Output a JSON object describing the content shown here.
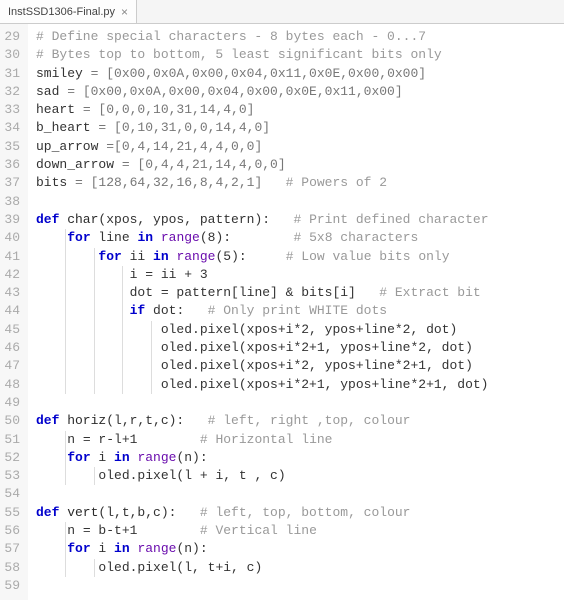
{
  "tab": {
    "filename": "InstSSD1306-Final.py",
    "close": "×"
  },
  "gutter_start": 29,
  "gutter_end": 59,
  "code": {
    "l29": {
      "comment": "# Define special characters - 8 bytes each - 0...7"
    },
    "l30": {
      "comment": "# Bytes top to bottom, 5 least significant bits only"
    },
    "l31": {
      "name": "smiley",
      "eq": " = ",
      "vals": "[0x00,0x0A,0x00,0x04,0x11,0x0E,0x00,0x00]"
    },
    "l32": {
      "name": "sad",
      "eq": " = ",
      "vals": "[0x00,0x0A,0x00,0x04,0x00,0x0E,0x11,0x00]"
    },
    "l33": {
      "name": "heart",
      "eq": " = ",
      "vals": "[0,0,0,10,31,14,4,0]"
    },
    "l34": {
      "name": "b_heart",
      "eq": " = ",
      "vals": "[0,10,31,0,0,14,4,0]"
    },
    "l35": {
      "name": "up_arrow",
      "eq": " =",
      "vals": "[0,4,14,21,4,4,0,0]"
    },
    "l36": {
      "name": "down_arrow",
      "eq": " = ",
      "vals": "[0,4,4,21,14,4,0,0]"
    },
    "l37": {
      "name": "bits",
      "eq": " = ",
      "vals": "[128,64,32,16,8,4,2,1]",
      "comment": "   # Powers of 2"
    },
    "l39": {
      "kw_def": "def",
      "fn": " char",
      "args": "(xpos, ypos, pattern):",
      "comment": "   # Print defined character"
    },
    "l40": {
      "indent": "    ",
      "kw_for": "for",
      "var": " line ",
      "kw_in": "in",
      "rng": " range",
      "args": "(8):",
      "comment": "        # 5x8 characters"
    },
    "l41": {
      "indent": "        ",
      "kw_for": "for",
      "var": " ii ",
      "kw_in": "in",
      "rng": " range",
      "args": "(5):",
      "comment": "     # Low value bits only"
    },
    "l42": {
      "indent": "            ",
      "expr": "i = ii + 3"
    },
    "l43": {
      "indent": "            ",
      "expr": "dot = pattern[line] & bits[i]",
      "comment": "   # Extract bit"
    },
    "l44": {
      "indent": "            ",
      "kw_if": "if",
      "expr": " dot:",
      "comment": "   # Only print WHITE dots"
    },
    "l45": {
      "indent": "                ",
      "call": "oled.pixel(xpos+i*2, ypos+line*2, dot)"
    },
    "l46": {
      "indent": "                ",
      "call": "oled.pixel(xpos+i*2+1, ypos+line*2, dot)"
    },
    "l47": {
      "indent": "                ",
      "call": "oled.pixel(xpos+i*2, ypos+line*2+1, dot)"
    },
    "l48": {
      "indent": "                ",
      "call": "oled.pixel(xpos+i*2+1, ypos+line*2+1, dot)"
    },
    "l50": {
      "kw_def": "def",
      "fn": " horiz",
      "args": "(l,r,t,c):",
      "comment": "   # left, right ,top, colour"
    },
    "l51": {
      "indent": "    ",
      "expr": "n = r-l+1",
      "comment": "        # Horizontal line"
    },
    "l52": {
      "indent": "    ",
      "kw_for": "for",
      "var": " i ",
      "kw_in": "in",
      "rng": " range",
      "args": "(n):"
    },
    "l53": {
      "indent": "        ",
      "call": "oled.pixel(l + i, t , c)"
    },
    "l55": {
      "kw_def": "def",
      "fn": " vert",
      "args": "(l,t,b,c):",
      "comment": "   # left, top, bottom, colour"
    },
    "l56": {
      "indent": "    ",
      "expr": "n = b-t+1",
      "comment": "        # Vertical line"
    },
    "l57": {
      "indent": "    ",
      "kw_for": "for",
      "var": " i ",
      "kw_in": "in",
      "rng": " range",
      "args": "(n):"
    },
    "l58": {
      "indent": "        ",
      "call": "oled.pixel(l, t+i, c)"
    }
  }
}
